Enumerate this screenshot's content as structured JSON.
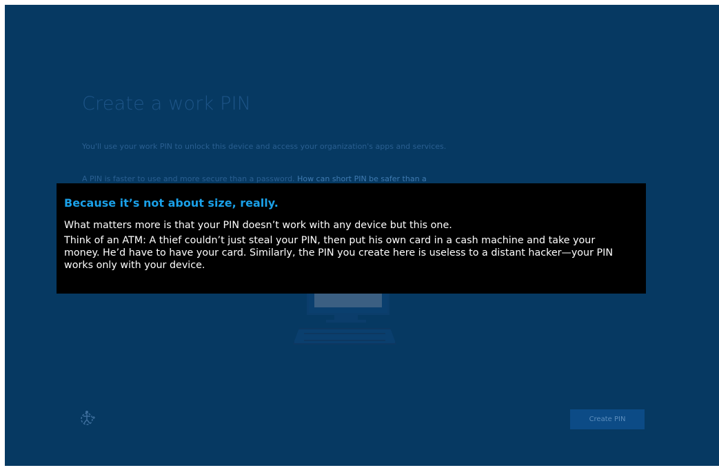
{
  "page": {
    "title": "Create a work PIN",
    "description": "You'll use your work PIN to unlock this device and access your organization's apps and services.",
    "pin_info_prefix": "A PIN is faster to use and more secure than a password.",
    "pin_info_link": "How can short PIN be safer than a"
  },
  "tooltip": {
    "heading": "Because it’s not about size, really.",
    "paragraph_1": "What matters more is that your PIN doesn’t work with any device but this one.",
    "paragraph_2": "Think of an ATM: A thief couldn’t just steal your PIN, then put his own card in a cash machine and take your money. He’d have to have your card. Similarly, the PIN you create here is useless to a distant hacker—your PIN works only with your device."
  },
  "footer": {
    "ease_of_access_icon": "ease-of-access-icon",
    "create_pin_label": "Create PIN"
  },
  "colors": {
    "background": "#063962",
    "tooltip_background": "#000000",
    "tooltip_heading": "#1aa0e8",
    "button": "#0c4b86"
  }
}
